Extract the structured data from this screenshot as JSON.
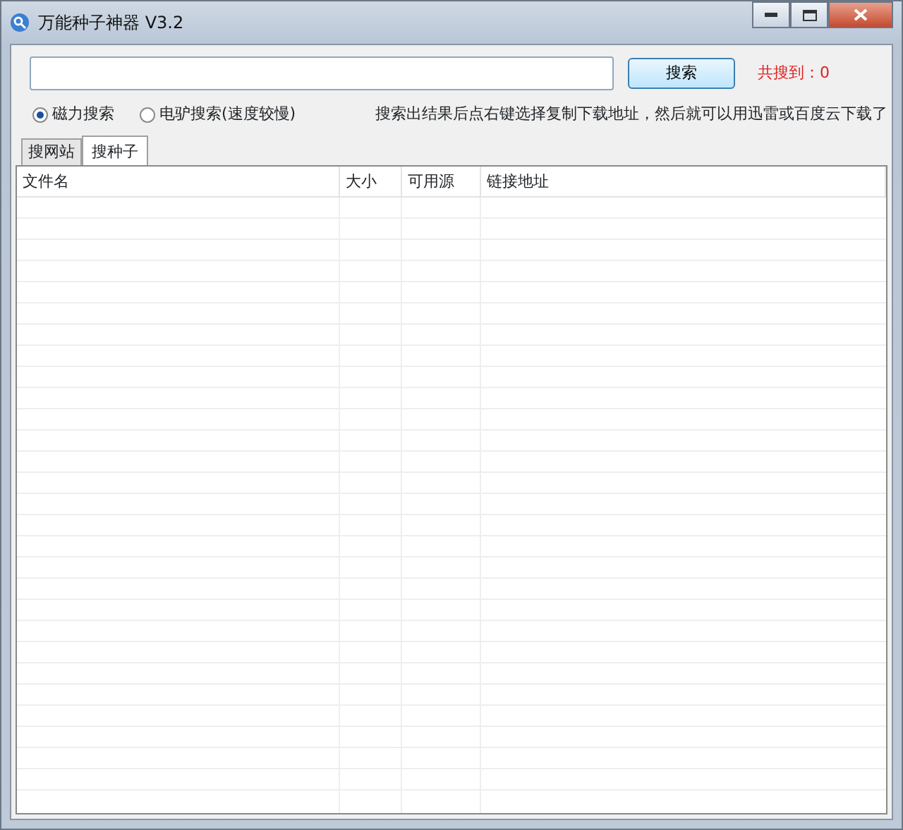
{
  "window": {
    "title": "万能种子神器 V3.2"
  },
  "search": {
    "button": "搜索",
    "result_count": "共搜到：0"
  },
  "modes": [
    {
      "label": "磁力搜索",
      "selected": true
    },
    {
      "label": "电驴搜索(速度较慢)",
      "selected": false
    }
  ],
  "hint": "搜索出结果后点右键选择复制下载地址，然后就可以用迅雷或百度云下载了",
  "tabs": [
    {
      "label": "搜网站",
      "selected": false
    },
    {
      "label": "搜种子",
      "selected": true
    }
  ],
  "table": {
    "columns": [
      "文件名",
      "大小",
      "可用源",
      "链接地址"
    ]
  }
}
